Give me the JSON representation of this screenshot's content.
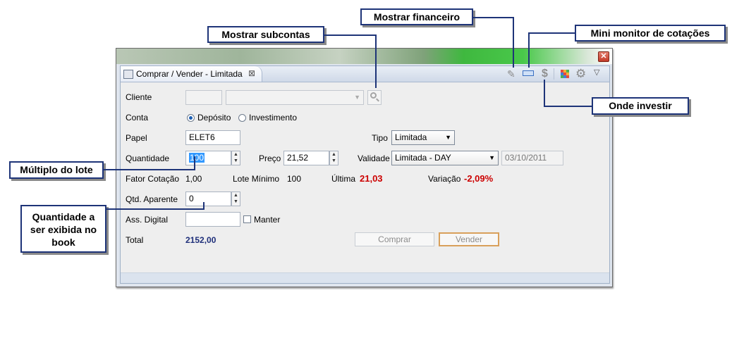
{
  "callouts": {
    "mostrar_financeiro": "Mostrar financeiro",
    "mostrar_subcontas": "Mostrar subcontas",
    "mini_monitor": "Mini monitor de cotações",
    "onde_investir": "Onde investir",
    "multiplo_lote": "Múltiplo do lote",
    "qtd_exibida_1": "Quantidade a",
    "qtd_exibida_2": "ser exibida no",
    "qtd_exibida_3": "book"
  },
  "window": {
    "tab_title": "Comprar / Vender - Limitada",
    "tab_close": "⊠"
  },
  "toolbar_icons": [
    "financeiro-icon",
    "mini-monitor-icon",
    "dollar-icon",
    "grid-icon",
    "gear-icon",
    "chevron-down-icon"
  ],
  "form": {
    "cliente_label": "Cliente",
    "conta_label": "Conta",
    "conta_option_deposito": "Depósito",
    "conta_option_investimento": "Investimento",
    "conta_selected": "Depósito",
    "papel_label": "Papel",
    "papel_value": "ELET6",
    "tipo_label": "Tipo",
    "tipo_value": "Limitada",
    "quantidade_label": "Quantidade",
    "quantidade_value": "100",
    "preco_label": "Preço",
    "preco_value": "21,52",
    "validade_label": "Validade",
    "validade_value": "Limitada - DAY",
    "validade_date": "03/10/2011",
    "fator_label": "Fator Cotação",
    "fator_value": "1,00",
    "lote_label": "Lote Mínimo",
    "lote_value": "100",
    "ultima_label": "Última",
    "ultima_value": "21,03",
    "variacao_label": "Variação",
    "variacao_value": "-2,09%",
    "qtd_aparente_label": "Qtd. Aparente",
    "qtd_aparente_value": "0",
    "ass_label": "Ass. Digital",
    "manter_label": "Manter",
    "total_label": "Total",
    "total_value": "2152,00"
  },
  "buttons": {
    "comprar": "Comprar",
    "vender": "Vender"
  },
  "colors": {
    "accent_blue": "#1e3478",
    "value_red": "#cc0000",
    "vender_border": "#d9a05b"
  }
}
